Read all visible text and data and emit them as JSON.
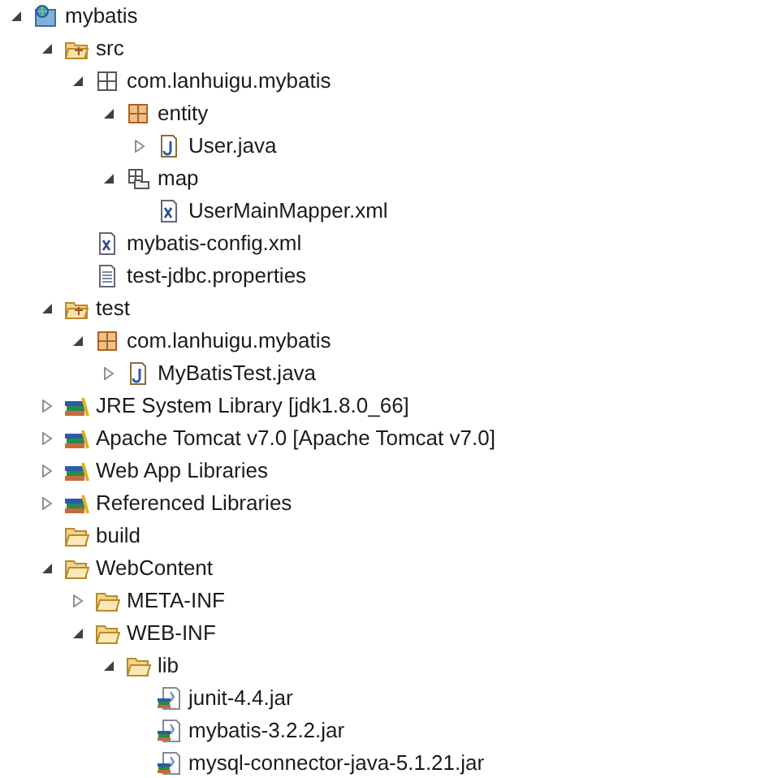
{
  "tree": [
    {
      "label": "mybatis",
      "kind": "project",
      "expanded": true,
      "children": [
        {
          "label": "src",
          "kind": "source-folder",
          "expanded": true,
          "children": [
            {
              "label": "com.lanhuigu.mybatis",
              "kind": "empty-package",
              "expanded": true,
              "children": [
                {
                  "label": "entity",
                  "kind": "package",
                  "expanded": true,
                  "children": [
                    {
                      "label": "User.java",
                      "kind": "java",
                      "expanded": false
                    }
                  ]
                },
                {
                  "label": "map",
                  "kind": "package-folder",
                  "expanded": true,
                  "children": [
                    {
                      "label": "UserMainMapper.xml",
                      "kind": "xml"
                    }
                  ]
                }
              ]
            },
            {
              "label": "mybatis-config.xml",
              "kind": "xml"
            },
            {
              "label": "test-jdbc.properties",
              "kind": "text-file"
            }
          ]
        },
        {
          "label": "test",
          "kind": "source-folder",
          "expanded": true,
          "children": [
            {
              "label": "com.lanhuigu.mybatis",
              "kind": "package",
              "expanded": true,
              "children": [
                {
                  "label": "MyBatisTest.java",
                  "kind": "java",
                  "expanded": false
                }
              ]
            }
          ]
        },
        {
          "label": "JRE System Library [jdk1.8.0_66]",
          "kind": "library",
          "expanded": false
        },
        {
          "label": "Apache Tomcat v7.0 [Apache Tomcat v7.0]",
          "kind": "library",
          "expanded": false
        },
        {
          "label": "Web App Libraries",
          "kind": "library",
          "expanded": false
        },
        {
          "label": "Referenced Libraries",
          "kind": "library",
          "expanded": false
        },
        {
          "label": "build",
          "kind": "folder"
        },
        {
          "label": "WebContent",
          "kind": "folder",
          "expanded": true,
          "children": [
            {
              "label": "META-INF",
              "kind": "folder",
              "expanded": false
            },
            {
              "label": "WEB-INF",
              "kind": "folder",
              "expanded": true,
              "children": [
                {
                  "label": "lib",
                  "kind": "folder",
                  "expanded": true,
                  "children": [
                    {
                      "label": "junit-4.4.jar",
                      "kind": "jar"
                    },
                    {
                      "label": "mybatis-3.2.2.jar",
                      "kind": "jar"
                    },
                    {
                      "label": "mysql-connector-java-5.1.21.jar",
                      "kind": "jar"
                    }
                  ]
                }
              ]
            }
          ]
        }
      ]
    }
  ]
}
